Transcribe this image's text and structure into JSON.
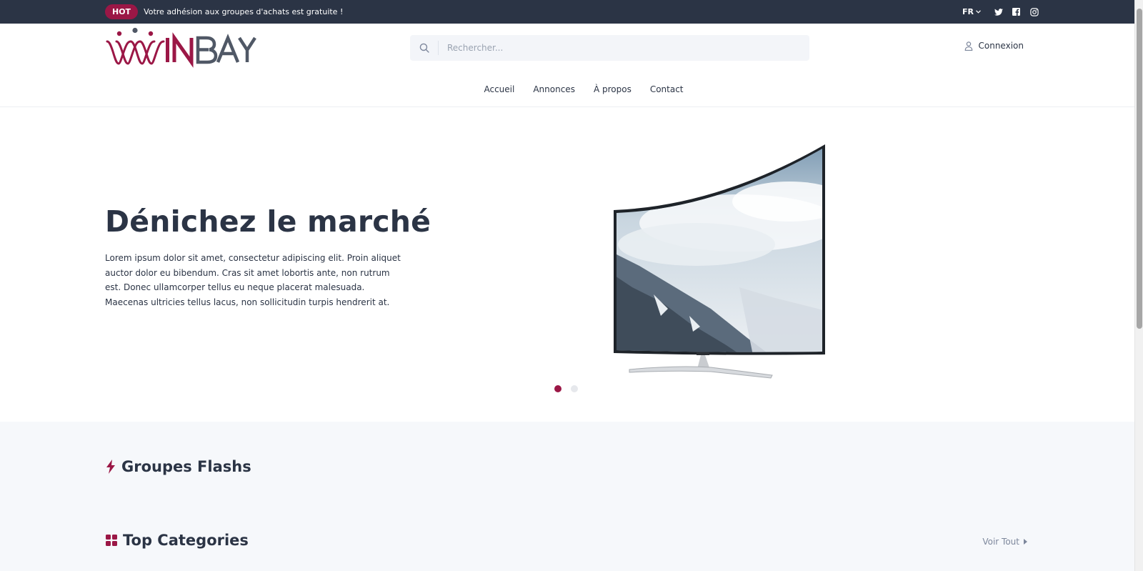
{
  "topbar": {
    "badge": "HOT",
    "promo": "Votre adhésion aux groupes d'achats est gratuite !",
    "language": "FR",
    "social_icons": [
      "twitter-icon",
      "facebook-icon",
      "instagram-icon"
    ]
  },
  "header": {
    "logo_text": "WINBAY",
    "search_placeholder": "Rechercher...",
    "login_label": "Connexion"
  },
  "nav": {
    "items": [
      "Accueil",
      "Annonces",
      "À propos",
      "Contact"
    ]
  },
  "hero": {
    "title": "Dénichez le marché",
    "text": "Lorem ipsum dolor sit amet, consectetur adipiscing elit. Proin aliquet auctor dolor eu bibendum. Cras sit amet lobortis ante, non rutrum est. Donec ullamcorper tellus eu neque placerat malesuada. Maecenas ultricies tellus lacus, non sollicitudin turpis hendrerit at.",
    "slide_count": 2,
    "active_slide": 1
  },
  "sections": {
    "flash_title": "Groupes Flashs",
    "categories_title": "Top Categories",
    "view_all": "Voir Tout"
  },
  "colors": {
    "brand": "#9b1746",
    "dark": "#2b3445",
    "muted": "#7d879c"
  }
}
